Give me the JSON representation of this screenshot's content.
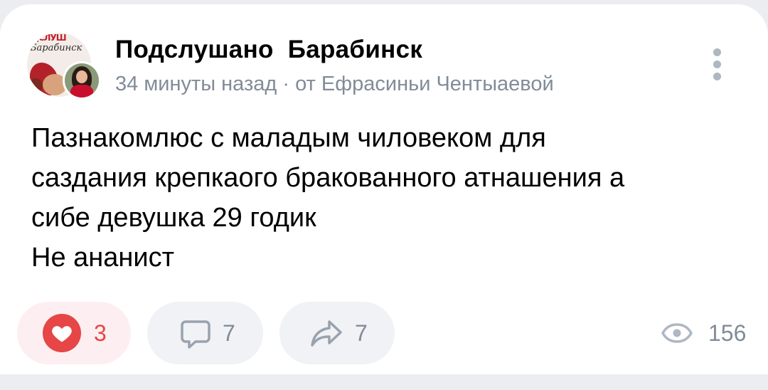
{
  "post": {
    "group_name": "Подслушано  Барабинск",
    "group_logo_text": "Барабинск",
    "group_logo_top": "ДСЛУШ",
    "meta": "34 минуты назад · от Ефрасиньи Чентыаевой",
    "text_lines": [
      "Пазнакомлюс с маладым чиловеком для",
      "сaздания крепкаого бракованного атнашения а",
      "сибе девушка 29 годик",
      "Не ананист"
    ]
  },
  "actions": {
    "likes": "3",
    "comments": "7",
    "shares": "7",
    "views": "156"
  },
  "icons": {
    "more": "more-vertical-icon",
    "like": "heart-icon",
    "comment": "comment-icon",
    "share": "share-icon",
    "views": "eye-icon"
  },
  "colors": {
    "like_accent": "#e64646",
    "muted_text": "#818c99",
    "pill_bg": "#f0f2f5",
    "like_pill_bg": "#fdeff1"
  }
}
